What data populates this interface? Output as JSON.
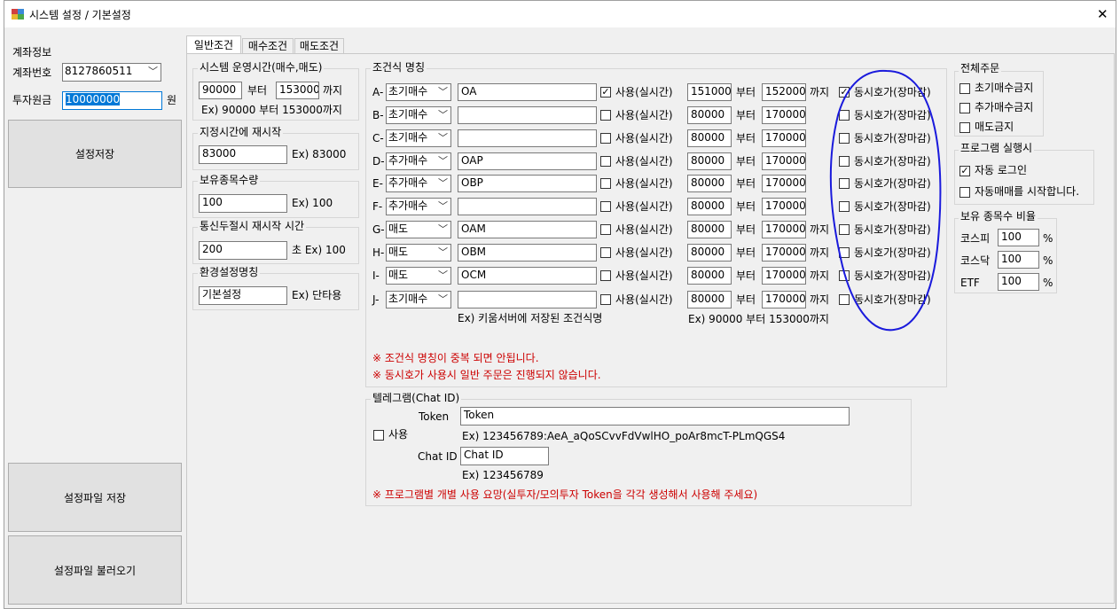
{
  "window": {
    "title": "시스템 설정 / 기본설정",
    "close_glyph": "✕"
  },
  "left": {
    "account_section": "계좌정보",
    "account_label": "계좌번호",
    "account_value": "8127860511",
    "principal_label": "투자원금",
    "principal_value": "10000000",
    "principal_unit": "원",
    "save_settings": "설정저장",
    "save_file": "설정파일 저장",
    "load_file": "설정파일 불러오기"
  },
  "tabs": [
    {
      "label": "일반조건"
    },
    {
      "label": "매수조건"
    },
    {
      "label": "매도조건"
    }
  ],
  "system_time": {
    "title": "시스템 운영시간(매수,매도)",
    "start": "90000",
    "from": "부터",
    "end": "153000",
    "to": "까지",
    "example": "Ex) 90000 부터 153000까지"
  },
  "restart_time": {
    "title": "지정시간에 재시작",
    "value": "83000",
    "example": "Ex) 83000"
  },
  "holding_count": {
    "title": "보유종목수량",
    "value": "100",
    "example": "Ex) 100"
  },
  "comm_restart": {
    "title": "통신두절시 재시작 시간",
    "value": "200",
    "example": "초 Ex) 100"
  },
  "env_name": {
    "title": "환경설정명칭",
    "value": "기본설정",
    "example": "Ex) 단타용"
  },
  "conditions": {
    "title": "조건식 명칭",
    "use_label": "사용(실시간)",
    "from": "부터",
    "to": "까지",
    "auction_label": "동시호가(장마감)",
    "rows": [
      {
        "id": "A-",
        "type": "초기매수",
        "name": "OA",
        "use": true,
        "start": "151000",
        "end": "152000",
        "show_to": true,
        "auction": true
      },
      {
        "id": "B-",
        "type": "초기매수",
        "name": "",
        "use": false,
        "start": "80000",
        "end": "170000",
        "show_to": false,
        "auction": false
      },
      {
        "id": "C-",
        "type": "초기매수",
        "name": "",
        "use": false,
        "start": "80000",
        "end": "170000",
        "show_to": false,
        "auction": false
      },
      {
        "id": "D-",
        "type": "추가매수",
        "name": "OAP",
        "use": false,
        "start": "80000",
        "end": "170000",
        "show_to": false,
        "auction": false
      },
      {
        "id": "E-",
        "type": "추가매수",
        "name": "OBP",
        "use": false,
        "start": "80000",
        "end": "170000",
        "show_to": false,
        "auction": false
      },
      {
        "id": "F-",
        "type": "추가매수",
        "name": "",
        "use": false,
        "start": "80000",
        "end": "170000",
        "show_to": false,
        "auction": false
      },
      {
        "id": "G-",
        "type": "매도",
        "name": "OAM",
        "use": false,
        "start": "80000",
        "end": "170000",
        "show_to": true,
        "auction": false
      },
      {
        "id": "H-",
        "type": "매도",
        "name": "OBM",
        "use": false,
        "start": "80000",
        "end": "170000",
        "show_to": true,
        "auction": false
      },
      {
        "id": "I-",
        "type": "매도",
        "name": "OCM",
        "use": false,
        "start": "80000",
        "end": "170000",
        "show_to": true,
        "auction": false
      },
      {
        "id": "J-",
        "type": "초기매수",
        "name": "",
        "use": false,
        "start": "80000",
        "end": "170000",
        "show_to": true,
        "auction": false
      }
    ],
    "name_example": "Ex) 키움서버에 저장된 조건식명",
    "time_example": "Ex) 90000 부터 153000까지",
    "warn1": "※ 조건식 명칭이 중복 되면 안됩니다.",
    "warn2": "※ 동시호가 사용시 일반 주문은 진행되지 않습니다."
  },
  "telegram": {
    "title": "텔레그램(Chat ID)",
    "token_label": "Token",
    "token_value": "Token",
    "use_label": "사용",
    "token_example": "Ex) 123456789:AeA_aQoSCvvFdVwlHO_poAr8mcT-PLmQGS4",
    "chat_label": "Chat ID",
    "chat_value": "Chat ID",
    "chat_example": "Ex) 123456789",
    "warn": "※ 프로그램별 개별 사용 요망(실투자/모의투자 Token을 각각 생성해서 사용해 주세요)"
  },
  "all_orders": {
    "title": "전체주문",
    "items": [
      {
        "label": "초기매수금지",
        "checked": false
      },
      {
        "label": "추가매수금지",
        "checked": false
      },
      {
        "label": "매도금지",
        "checked": false
      }
    ]
  },
  "program_run": {
    "title": "프로그램 실행시",
    "items": [
      {
        "label": "자동 로그인",
        "checked": true
      },
      {
        "label": "자동매매를 시작합니다.",
        "checked": false
      }
    ]
  },
  "holding_ratio": {
    "title": "보유 종목수 비율",
    "items": [
      {
        "label": "코스피",
        "value": "100",
        "unit": "%"
      },
      {
        "label": "코스닥",
        "value": "100",
        "unit": "%"
      },
      {
        "label": "ETF",
        "value": "100",
        "unit": "%"
      }
    ]
  },
  "colors": {
    "window_bg": "#f0f0f0",
    "accent": "#0078d7",
    "warning": "#cc0000",
    "annotation": "#1a1adc"
  }
}
